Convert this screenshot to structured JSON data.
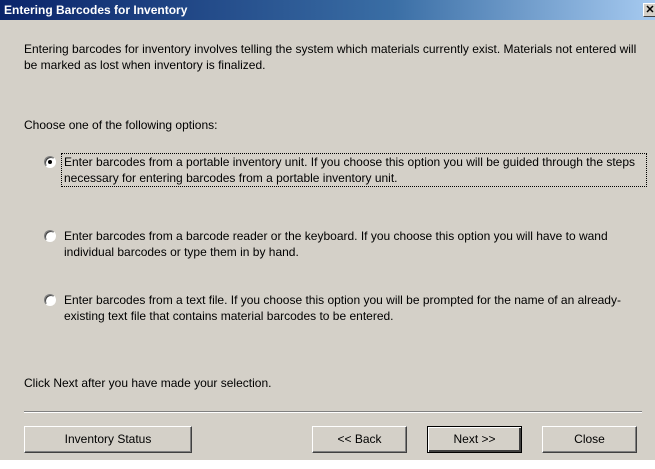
{
  "window": {
    "title": "Entering Barcodes for Inventory",
    "close_glyph": "✕"
  },
  "intro": "Entering barcodes for inventory involves telling the system which materials currently exist.  Materials not entered will be marked as lost when inventory is finalized.",
  "choose_prompt": "Choose one of the following options:",
  "options": [
    {
      "label": "Enter barcodes from a portable inventory unit.  If you choose this option you will be guided through the steps necessary for entering barcodes from a portable inventory unit.",
      "selected": true
    },
    {
      "label": "Enter barcodes from a barcode reader or the keyboard.  If you choose this option you will have to wand individual barcodes or type them in by hand.",
      "selected": false
    },
    {
      "label": "Enter barcodes from a text file.  If you choose this option you will be prompted for the name of an already-existing text file that contains material barcodes to be entered.",
      "selected": false
    }
  ],
  "click_next": "Click Next after you have made your selection.",
  "buttons": {
    "inventory_status": "Inventory Status",
    "back": "<< Back",
    "next": "Next >>",
    "close": "Close"
  }
}
